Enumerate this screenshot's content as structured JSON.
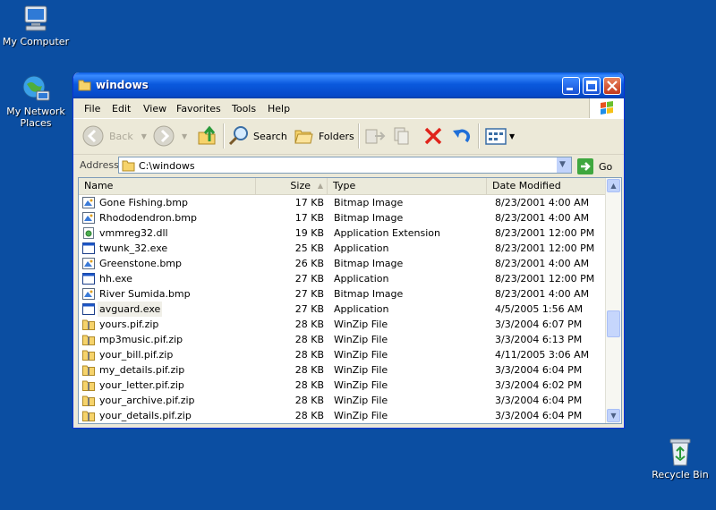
{
  "desktop": {
    "my_computer": "My Computer",
    "my_network_line1": "My Network",
    "my_network_line2": "Places",
    "recycle_bin": "Recycle Bin"
  },
  "window": {
    "title": "windows",
    "menu": [
      "File",
      "Edit",
      "View",
      "Favorites",
      "Tools",
      "Help"
    ],
    "toolbar": {
      "back": "Back",
      "search": "Search",
      "folders": "Folders"
    },
    "address": {
      "label": "Address",
      "value": "C:\\windows",
      "go": "Go"
    }
  },
  "columns": [
    "Name",
    "Size",
    "Type",
    "Date Modified"
  ],
  "files": [
    {
      "name": "Gone Fishing.bmp",
      "size": "17 KB",
      "type": "Bitmap Image",
      "date": "8/23/2001 4:00 AM",
      "icon": "bitmap-icon"
    },
    {
      "name": "Rhododendron.bmp",
      "size": "17 KB",
      "type": "Bitmap Image",
      "date": "8/23/2001 4:00 AM",
      "icon": "bitmap-icon"
    },
    {
      "name": "vmmreg32.dll",
      "size": "19 KB",
      "type": "Application Extension",
      "date": "8/23/2001 12:00 PM",
      "icon": "dll-icon"
    },
    {
      "name": "twunk_32.exe",
      "size": "25 KB",
      "type": "Application",
      "date": "8/23/2001 12:00 PM",
      "icon": "exe-icon"
    },
    {
      "name": "Greenstone.bmp",
      "size": "26 KB",
      "type": "Bitmap Image",
      "date": "8/23/2001 4:00 AM",
      "icon": "bitmap-icon"
    },
    {
      "name": "hh.exe",
      "size": "27 KB",
      "type": "Application",
      "date": "8/23/2001 12:00 PM",
      "icon": "exe-icon"
    },
    {
      "name": "River Sumida.bmp",
      "size": "27 KB",
      "type": "Bitmap Image",
      "date": "8/23/2001 4:00 AM",
      "icon": "bitmap-icon"
    },
    {
      "name": "avguard.exe",
      "size": "27 KB",
      "type": "Application",
      "date": "4/5/2005 1:56 AM",
      "icon": "exe-icon"
    },
    {
      "name": "yours.pif.zip",
      "size": "28 KB",
      "type": "WinZip File",
      "date": "3/3/2004 6:07 PM",
      "icon": "zip-icon"
    },
    {
      "name": "mp3music.pif.zip",
      "size": "28 KB",
      "type": "WinZip File",
      "date": "3/3/2004 6:13 PM",
      "icon": "zip-icon"
    },
    {
      "name": "your_bill.pif.zip",
      "size": "28 KB",
      "type": "WinZip File",
      "date": "4/11/2005 3:06 AM",
      "icon": "zip-icon"
    },
    {
      "name": "my_details.pif.zip",
      "size": "28 KB",
      "type": "WinZip File",
      "date": "3/3/2004 6:04 PM",
      "icon": "zip-icon"
    },
    {
      "name": "your_letter.pif.zip",
      "size": "28 KB",
      "type": "WinZip File",
      "date": "3/3/2004 6:02 PM",
      "icon": "zip-icon"
    },
    {
      "name": "your_archive.pif.zip",
      "size": "28 KB",
      "type": "WinZip File",
      "date": "3/3/2004 6:04 PM",
      "icon": "zip-icon"
    },
    {
      "name": "your_details.pif.zip",
      "size": "28 KB",
      "type": "WinZip File",
      "date": "3/3/2004 6:04 PM",
      "icon": "zip-icon"
    }
  ],
  "colors": {
    "desktop": "#0b4ea2",
    "titlebar": "#0a5ce4",
    "window": "#ece9d8"
  }
}
